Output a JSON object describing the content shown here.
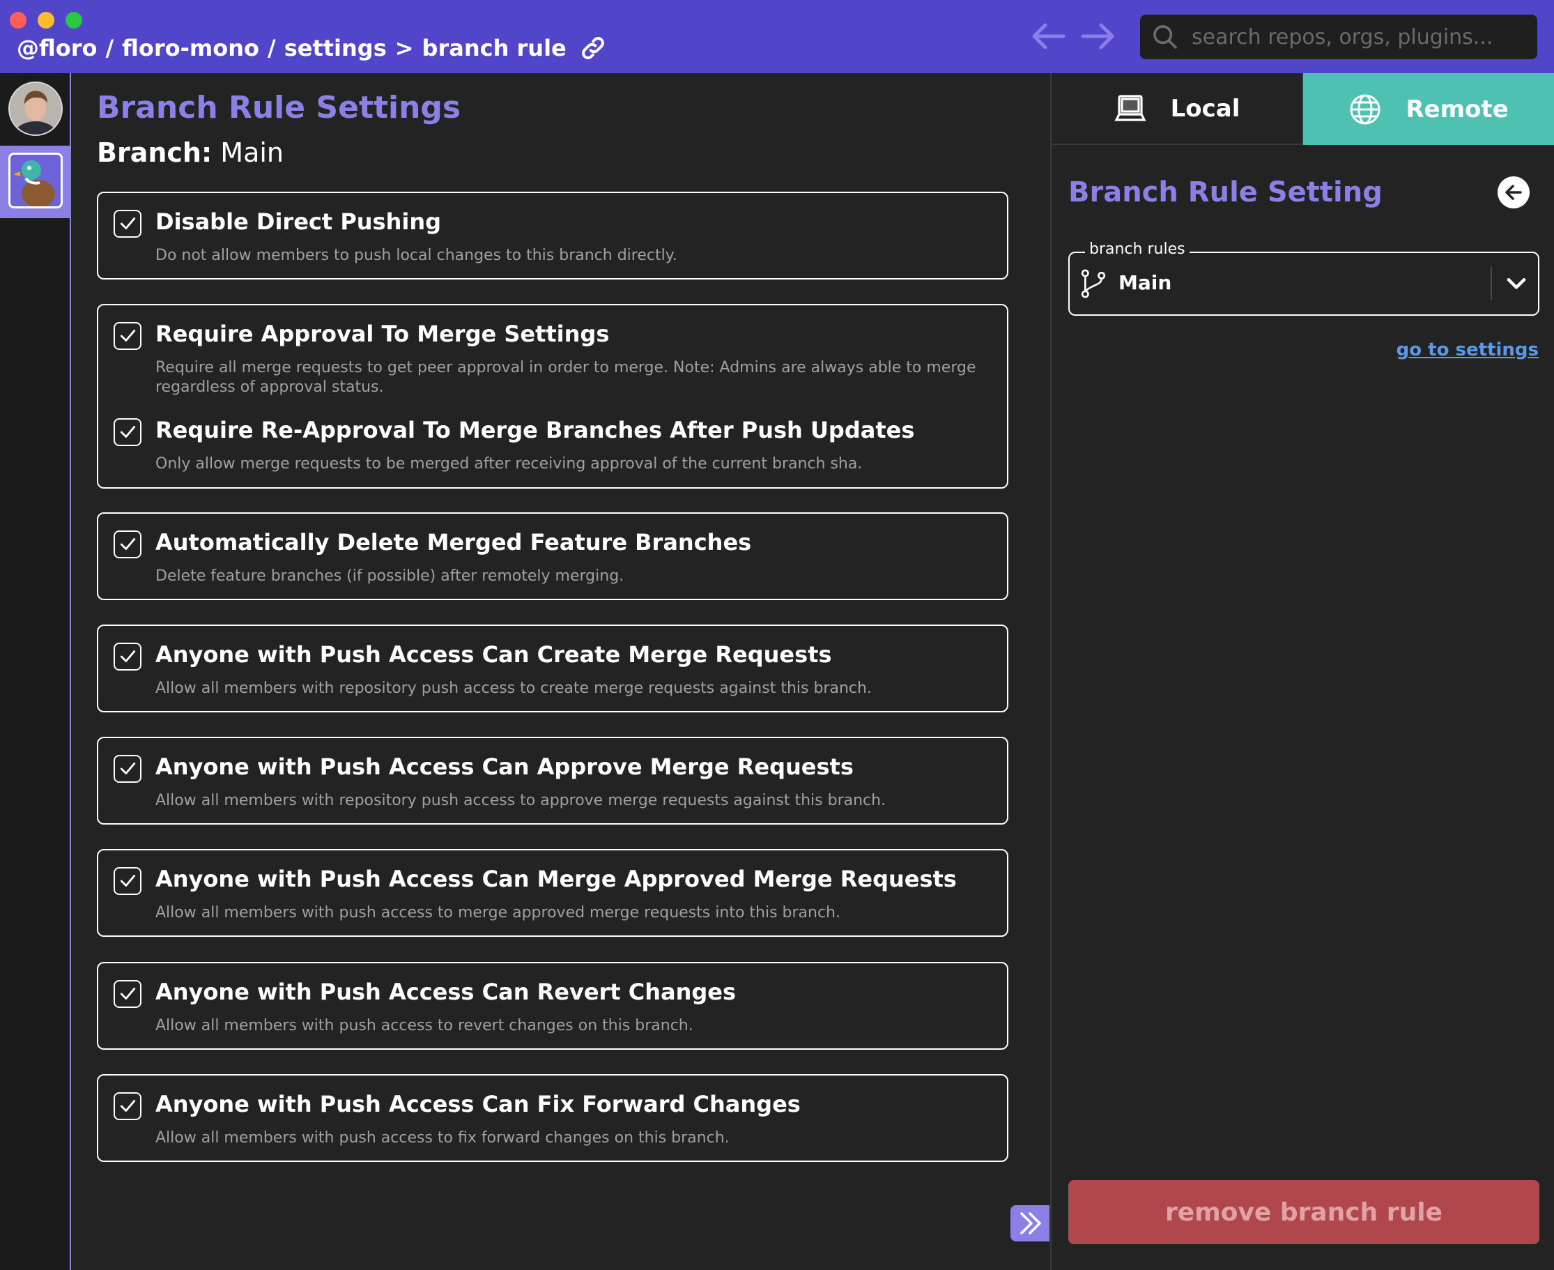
{
  "window": {
    "breadcrumb": [
      "@floro",
      "floro-mono",
      "settings",
      "branch rule"
    ],
    "breadcrumb_separators": [
      "/",
      "/",
      ">"
    ],
    "search_placeholder": "search repos, orgs, plugins..."
  },
  "main": {
    "title": "Branch Rule Settings",
    "branch_label": "Branch:",
    "branch_name": "Main",
    "cards": [
      {
        "options": [
          {
            "checked": true,
            "title": "Disable Direct Pushing",
            "desc": "Do not allow members to push local changes to this branch directly."
          }
        ]
      },
      {
        "options": [
          {
            "checked": true,
            "title": "Require Approval To Merge Settings",
            "desc": "Require all merge requests to get peer approval in order to merge. Note: Admins are always able to merge regardless of approval status."
          },
          {
            "checked": true,
            "title": "Require Re-Approval To Merge Branches After Push Updates",
            "desc": "Only allow merge requests to be merged after receiving approval of the current branch sha."
          }
        ]
      },
      {
        "options": [
          {
            "checked": true,
            "title": "Automatically Delete Merged Feature Branches",
            "desc": "Delete feature branches (if possible) after remotely merging."
          }
        ]
      },
      {
        "options": [
          {
            "checked": true,
            "title": "Anyone with Push Access Can Create Merge Requests",
            "desc": "Allow all members with repository push access to create merge requests against this branch."
          }
        ]
      },
      {
        "options": [
          {
            "checked": true,
            "title": "Anyone with Push Access Can Approve Merge Requests",
            "desc": "Allow all members with repository push access to approve merge requests against this branch."
          }
        ]
      },
      {
        "options": [
          {
            "checked": true,
            "title": "Anyone with Push Access Can Merge Approved Merge Requests",
            "desc": "Allow all members with push access to merge approved merge requests into this branch."
          }
        ]
      },
      {
        "options": [
          {
            "checked": true,
            "title": "Anyone with Push Access Can Revert Changes",
            "desc": "Allow all members with push access to revert changes on this branch."
          }
        ]
      },
      {
        "options": [
          {
            "checked": true,
            "title": "Anyone with Push Access Can Fix Forward Changes",
            "desc": "Allow all members with push access to fix forward changes on this branch."
          }
        ]
      }
    ]
  },
  "side": {
    "tabs": {
      "local": "Local",
      "remote": "Remote",
      "active": "remote"
    },
    "title": "Branch Rule Setting",
    "select_label": "branch rules",
    "select_value": "Main",
    "goto_settings": "go to settings",
    "remove_button": "remove branch rule"
  },
  "colors": {
    "accent": "#8a80e6",
    "titlebar": "#5146c9",
    "remote_tab": "#4fc1b2",
    "danger": "#b0474c",
    "link": "#5a9ae8"
  }
}
